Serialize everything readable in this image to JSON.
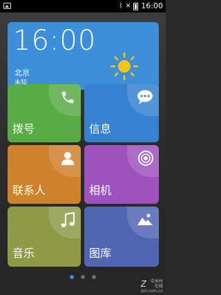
{
  "status_bar": {
    "time": "16:00",
    "icons": [
      "image-notification-icon",
      "bluetooth-icon",
      "no-signal-icon",
      "battery-icon"
    ]
  },
  "weather": {
    "time": "16:00",
    "city": "北京",
    "condition": "未知",
    "icon": "sun-icon"
  },
  "tiles": [
    {
      "label": "拨号",
      "icon": "phone-icon",
      "color": "#58ab45"
    },
    {
      "label": "信息",
      "icon": "message-icon",
      "color": "#3682d0"
    },
    {
      "label": "联系人",
      "icon": "contact-icon",
      "color": "#d0812c"
    },
    {
      "label": "相机",
      "icon": "camera-icon",
      "color": "#9d52bd"
    },
    {
      "label": "音乐",
      "icon": "music-icon",
      "color": "#8e9a46"
    },
    {
      "label": "图库",
      "icon": "gallery-icon",
      "color": "#5066b2"
    }
  ],
  "pager": {
    "pages": 3,
    "current": 1
  },
  "watermark": {
    "logo": "Z",
    "line1": "中关村在线",
    "line2": "zol.com.cn"
  }
}
